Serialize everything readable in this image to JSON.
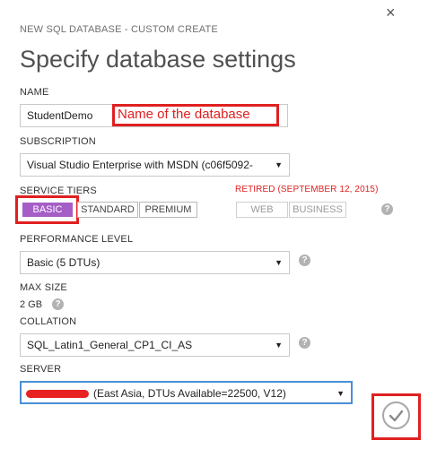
{
  "dialog": {
    "subtitle": "NEW SQL DATABASE - CUSTOM CREATE",
    "title": "Specify database settings",
    "close_symbol": "×"
  },
  "name": {
    "label": "NAME",
    "value": "StudentDemo",
    "annotation": "Name of the database"
  },
  "subscription": {
    "label": "SUBSCRIPTION",
    "value": "Visual Studio Enterprise with MSDN (c06f5092-"
  },
  "service_tiers": {
    "label": "SERVICE TIERS",
    "retired_label": "RETIRED (SEPTEMBER 12, 2015)",
    "tiers": [
      "BASIC",
      "STANDARD",
      "PREMIUM"
    ],
    "retired_tiers": [
      "WEB",
      "BUSINESS"
    ],
    "selected": "BASIC"
  },
  "performance": {
    "label": "PERFORMANCE LEVEL",
    "value": "Basic (5 DTUs)"
  },
  "max_size": {
    "label": "MAX SIZE",
    "value": "2 GB"
  },
  "collation": {
    "label": "COLLATION",
    "value": "SQL_Latin1_General_CP1_CI_AS"
  },
  "server": {
    "label": "SERVER",
    "value": "(East Asia, DTUs Available=22500, V12)"
  },
  "icons": {
    "help": "?",
    "dropdown": "▼",
    "complete": "checkmark-icon"
  },
  "colors": {
    "annotation_red": "#e02020",
    "basic_tier": "#a55ec6",
    "help_gray": "#b2b2b2"
  }
}
